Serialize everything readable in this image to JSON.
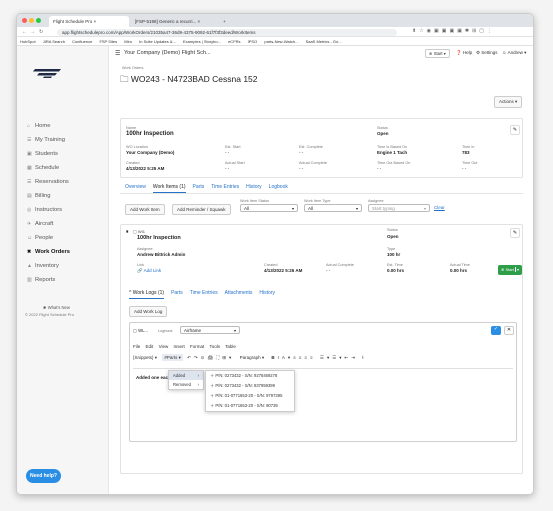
{
  "browser": {
    "tabs": [
      "Flight Schedule Pro",
      "[FSP-5198] Generic a recurri..."
    ],
    "url": "app.flightschedulepro.com/App/WorkOrders/21035a47-36d9-4375-9092-61f7f3f3deed/WorkItems",
    "bookmarks": [
      "HubSpot",
      "JIRA Search",
      "Confluence",
      "FSP Sites",
      "Miro",
      "In Suite Updates &...",
      "Examples | Storybo...",
      "eCFRs",
      "IPSO",
      "parts-New-Watch...",
      "SaaS Metrics - Go..."
    ]
  },
  "header": {
    "company": "Your Company (Demo) Flight Sch...",
    "start": "Start",
    "help": "Help",
    "settings": "Settings",
    "user": "Andrew"
  },
  "sidebar": {
    "items": [
      {
        "label": "Home",
        "icon": "⌂"
      },
      {
        "label": "My Training",
        "icon": "☰"
      },
      {
        "label": "Students",
        "icon": "▣"
      },
      {
        "label": "Schedule",
        "icon": "▦"
      },
      {
        "label": "Reservations",
        "icon": "☰"
      },
      {
        "label": "Billing",
        "icon": "▤"
      },
      {
        "label": "Instructors",
        "icon": "◎"
      },
      {
        "label": "Aircraft",
        "icon": "✈"
      },
      {
        "label": "People",
        "icon": "☺"
      },
      {
        "label": "Work Orders",
        "icon": "✖"
      },
      {
        "label": "Inventory",
        "icon": "▲"
      },
      {
        "label": "Reports",
        "icon": "▥"
      }
    ],
    "whats_new": "What's New",
    "copyright": "© 2022 Flight Schedule Pro",
    "need_help": "Need help?"
  },
  "page": {
    "breadcrumb": "Work Orders",
    "title": "WO243 - N4723BAD Cessna 152",
    "actions": "Actions"
  },
  "summary": {
    "name_label": "Name",
    "name": "100hr Inspection",
    "status_label": "Status",
    "status": "Open",
    "loc_label": "WO Location",
    "loc": "Your Company (Demo)",
    "est_start_label": "Est. Start",
    "est_start": "- -",
    "est_complete_label": "Est. Complete",
    "est_complete": "- -",
    "time_basis_label": "Time Is Based On",
    "time_basis": "Engine 1 Tach",
    "time_in_label": "Time In",
    "time_in": "783",
    "created_label": "Created",
    "created": "4/13/2022 5:25 AM",
    "actual_start_label": "Actual Start",
    "actual_start": "- -",
    "actual_complete_label": "Actual Complete",
    "actual_complete": "- -",
    "time_out_basis_label": "Time Out Based On",
    "time_out_basis": "- -",
    "time_out_label": "Time Out",
    "time_out": "- -"
  },
  "maintabs": [
    "Overview",
    "Work Items (1)",
    "Parts",
    "Time Entries",
    "History",
    "Logbook"
  ],
  "filters": {
    "add_item": "Add Work Item",
    "add_reminder": "Add Reminder / Squawk",
    "status_label": "Work Item Status",
    "status_value": "All",
    "type_label": "Work Item Type",
    "type_value": "All",
    "assignee_label": "Assignee",
    "assignee_placeholder": "Start typing",
    "clear": "Clear"
  },
  "workitem": {
    "id": "WI1",
    "title": "100hr Inspection",
    "status_label": "Status",
    "status": "Open",
    "assignee_label": "Assignee",
    "assignee": "Andrew Bittrick Admin",
    "type_label": "Type",
    "type": "100 hr",
    "link_label": "Link",
    "link": "Add Link",
    "created_label": "Created",
    "created": "4/13/2022 5:26 AM",
    "actual_complete_label": "Actual Complete",
    "actual_complete": "- -",
    "est_time_label": "Est. Time",
    "est_time": "0.00 hrs",
    "actual_time_label": "Actual Time",
    "actual_time": "0.00 hrs",
    "start": "Start",
    "subtabs": [
      "Work Logs (1)",
      "Parts",
      "Time Entries",
      "Attachments",
      "History"
    ],
    "add_log": "Add Work Log"
  },
  "editor": {
    "wl": "WL...",
    "logbook_label": "Logbook",
    "logbook_value": "Airframe",
    "menubar": [
      "File",
      "Edit",
      "View",
      "Insert",
      "Format",
      "Tools",
      "Table"
    ],
    "snippets": "{Snippets}",
    "parts": "#Parts",
    "paragraph": "Paragraph",
    "body_text": "Added one eac",
    "submenu": [
      "Added",
      "Removed"
    ],
    "parts_list": [
      "P/N: 0273432 - S/N: 9278469278",
      "P/N: 0273432 - S/N: 837959399",
      "P/N: 01-0771653-20 - S/N: 9797395",
      "P/N: 01-0771653-20 - S/N: 90739"
    ]
  },
  "colors": {
    "accent": "#2672c7",
    "start_green": "#2e9e49",
    "need_help": "#2b8ee5"
  }
}
